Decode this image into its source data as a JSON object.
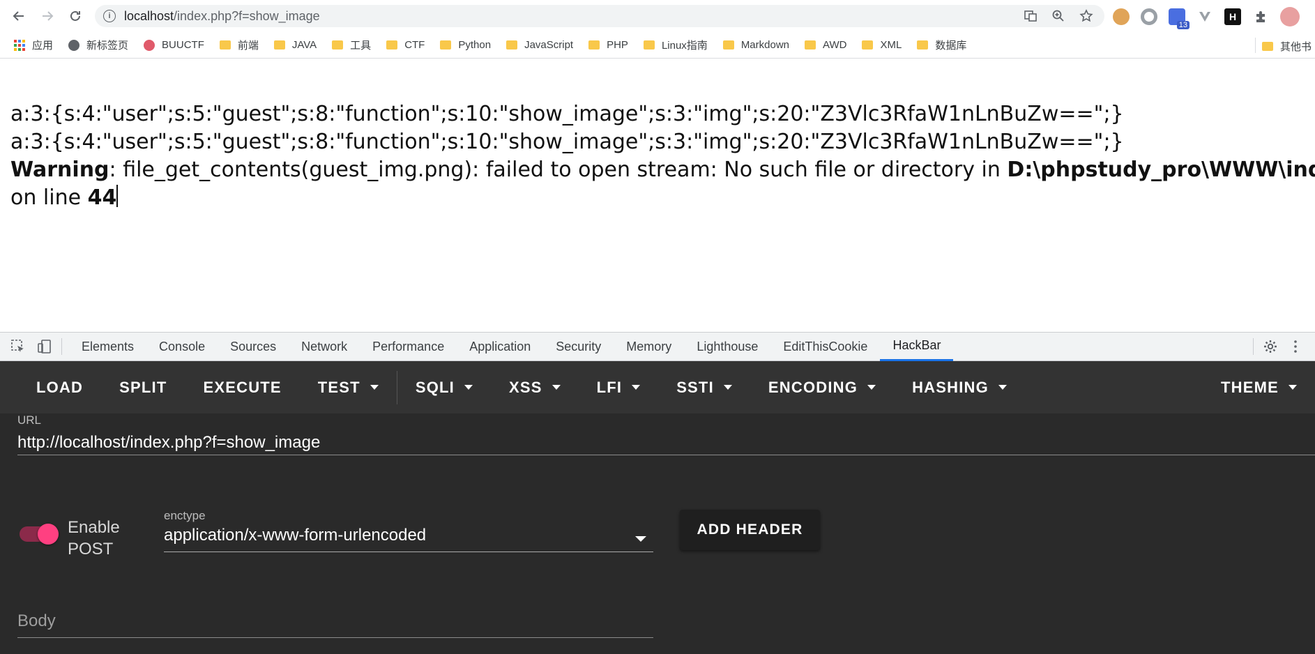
{
  "browser": {
    "url_host": "localhost",
    "url_path": "/index.php?f=show_image",
    "extension_badge": "13"
  },
  "bookmarks": [
    {
      "label": "应用",
      "type": "apps"
    },
    {
      "label": "新标签页",
      "type": "globe"
    },
    {
      "label": "BUUCTF",
      "type": "site"
    },
    {
      "label": "前端",
      "type": "folder"
    },
    {
      "label": "JAVA",
      "type": "folder"
    },
    {
      "label": "工具",
      "type": "folder"
    },
    {
      "label": "CTF",
      "type": "folder"
    },
    {
      "label": "Python",
      "type": "folder"
    },
    {
      "label": "JavaScript",
      "type": "folder"
    },
    {
      "label": "PHP",
      "type": "folder"
    },
    {
      "label": "Linux指南",
      "type": "folder"
    },
    {
      "label": "Markdown",
      "type": "folder"
    },
    {
      "label": "AWD",
      "type": "folder"
    },
    {
      "label": "XML",
      "type": "folder"
    },
    {
      "label": "数据库",
      "type": "folder"
    }
  ],
  "bookmarks_other": "其他书",
  "page": {
    "line1": "a:3:{s:4:\"user\";s:5:\"guest\";s:8:\"function\";s:10:\"show_image\";s:3:\"img\";s:20:\"Z3Vlc3RfaW1nLnBuZw==\";}",
    "line2": "a:3:{s:4:\"user\";s:5:\"guest\";s:8:\"function\";s:10:\"show_image\";s:3:\"img\";s:20:\"Z3Vlc3RfaW1nLnBuZw==\";}",
    "warning_label": "Warning",
    "warning_text": ": file_get_contents(guest_img.png): failed to open stream: No such file or directory in ",
    "warning_path": "D:\\phpstudy_pro\\WWW\\index.php",
    "line_prefix": "on line ",
    "line_number": "44"
  },
  "devtools": {
    "tabs": [
      "Elements",
      "Console",
      "Sources",
      "Network",
      "Performance",
      "Application",
      "Security",
      "Memory",
      "Lighthouse",
      "EditThisCookie",
      "HackBar"
    ],
    "active_tab": "HackBar"
  },
  "hackbar": {
    "buttons": [
      {
        "label": "LOAD",
        "dropdown": false
      },
      {
        "label": "SPLIT",
        "dropdown": false
      },
      {
        "label": "EXECUTE",
        "dropdown": false
      },
      {
        "label": "TEST",
        "dropdown": true
      }
    ],
    "menus": [
      {
        "label": "SQLI",
        "dropdown": true
      },
      {
        "label": "XSS",
        "dropdown": true
      },
      {
        "label": "LFI",
        "dropdown": true
      },
      {
        "label": "SSTI",
        "dropdown": true
      },
      {
        "label": "ENCODING",
        "dropdown": true
      },
      {
        "label": "HASHING",
        "dropdown": true
      }
    ],
    "theme_label": "THEME",
    "url_label": "URL",
    "url_value": "http://localhost/index.php?f=show_image",
    "enable_post_label": "Enable POST",
    "enable_post_on": true,
    "enctype_label": "enctype",
    "enctype_value": "application/x-www-form-urlencoded",
    "add_header_label": "ADD HEADER",
    "body_placeholder": "Body",
    "accent_color": "#ff4081"
  }
}
